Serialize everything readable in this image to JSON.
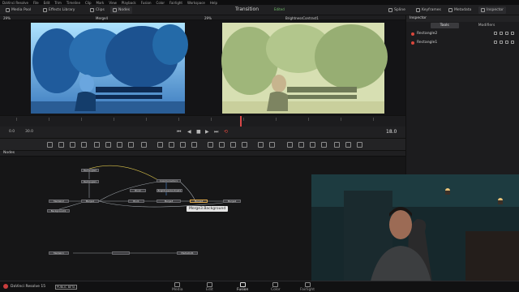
{
  "menu": [
    "DaVinci Resolve",
    "File",
    "Edit",
    "Trim",
    "Timeline",
    "Clip",
    "Mark",
    "View",
    "Playback",
    "Fusion",
    "Color",
    "Fairlight",
    "Workspace",
    "Help"
  ],
  "toolbar": {
    "media_pool": "Media Pool",
    "effects_library": "Effects Library",
    "clips": "Clips",
    "nodes": "Nodes",
    "title": "Transition",
    "status": "Edited",
    "spline": "Spline",
    "keyframes": "Keyframes",
    "metadata": "Metadata",
    "inspector": "Inspector"
  },
  "viewer_left": {
    "zoom": "29%",
    "title": "Merge4"
  },
  "viewer_right": {
    "zoom": "29%",
    "title": "BrightnessContrast1"
  },
  "transport": {
    "start": "0.0",
    "end": "30.0",
    "current": "18.0"
  },
  "nodes_panel": {
    "title": "Nodes"
  },
  "nodes": [
    {
      "label": "Rectangle2"
    },
    {
      "label": "Rectangle1"
    },
    {
      "label": "MediaIn2"
    },
    {
      "label": "Merge1"
    },
    {
      "label": "Background1"
    },
    {
      "label": "ColorCorrector1"
    },
    {
      "label": "Blur2"
    },
    {
      "label": "BrightnessContrast1"
    },
    {
      "label": "Blur1"
    },
    {
      "label": "Merge3"
    },
    {
      "label": "Merge4"
    },
    {
      "label": "Merge2"
    },
    {
      "label": "MediaIn1"
    },
    {
      "label": "MediaOut1"
    }
  ],
  "tooltip": "Merge3.Background",
  "inspector": {
    "title": "Inspector",
    "tabs": [
      "Tools",
      "Modifiers"
    ],
    "items": [
      {
        "label": "Rectangle2"
      },
      {
        "label": "Rectangle1"
      }
    ]
  },
  "bottom": {
    "app": "DaVinci Resolve 15",
    "badge": "PUBLIC BETA",
    "pages": [
      "Media",
      "Edit",
      "Fusion",
      "Color",
      "Fairlight"
    ],
    "active_page": "Fusion"
  },
  "colors": {
    "accent_orange": "#e0a94a",
    "edited_green": "#6fbd6a",
    "record_red": "#d9473c"
  }
}
